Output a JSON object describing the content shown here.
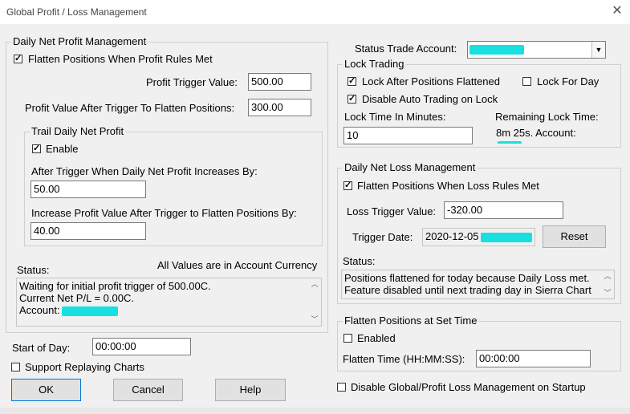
{
  "window": {
    "title": "Global Profit / Loss Management",
    "close_glyph": "✕"
  },
  "profit": {
    "legend": "Daily Net Profit Management",
    "flatten_label": "Flatten Positions When Profit Rules Met",
    "flatten_checked": true,
    "trigger_label": "Profit Trigger Value:",
    "trigger_value": "500.00",
    "after_label": "Profit Value After Trigger To Flatten Positions:",
    "after_value": "300.00",
    "trail": {
      "legend": "Trail Daily Net Profit",
      "enable_label": "Enable",
      "enable_checked": true,
      "increase_label": "After Trigger When Daily Net Profit Increases By:",
      "increase_value": "50.00",
      "increase_after_label": "Increase Profit Value After Trigger to Flatten Positions By:",
      "increase_after_value": "40.00"
    },
    "status_label": "Status:",
    "currency_note": "All Values are in Account Currency",
    "status_lines": [
      "Waiting for initial profit trigger of 500.00C.",
      "Current Net P/L = 0.00C.",
      "Account:"
    ]
  },
  "start_of_day": {
    "label": "Start of Day:",
    "value": "00:00:00"
  },
  "support_replay": {
    "label": "Support Replaying Charts",
    "checked": false
  },
  "buttons": {
    "ok": "OK",
    "cancel": "Cancel",
    "help": "Help",
    "reset": "Reset"
  },
  "status_trade_account": {
    "label": "Status Trade Account:",
    "value": ""
  },
  "lock": {
    "legend": "Lock Trading",
    "after_flatten_label": "Lock After Positions Flattened",
    "after_flatten_checked": true,
    "for_day_label": "Lock For Day",
    "for_day_checked": false,
    "disable_auto_label": "Disable Auto Trading on Lock",
    "disable_auto_checked": true,
    "time_label": "Lock Time In Minutes:",
    "time_value": "10",
    "remaining_label": "Remaining Lock Time:",
    "remaining_value": "8m 25s. Account:"
  },
  "loss": {
    "legend": "Daily Net Loss Management",
    "flatten_label": "Flatten Positions When Loss Rules Met",
    "flatten_checked": true,
    "trigger_label": "Loss Trigger Value:",
    "trigger_value": "-320.00",
    "date_label": "Trigger Date:",
    "date_value": "2020-12-05",
    "status_label": "Status:",
    "status_lines": [
      "Positions flattened for today because Daily Loss met.",
      "Feature disabled until next trading day in Sierra Chart"
    ]
  },
  "flatten_time": {
    "legend": "Flatten Positions at Set Time",
    "enabled_label": "Enabled",
    "enabled_checked": false,
    "time_label": "Flatten Time (HH:MM:SS):",
    "time_value": "00:00:00"
  },
  "disable_global": {
    "label": "Disable Global/Profit Loss Management on Startup",
    "checked": false
  },
  "colors": {
    "redaction": "#18e0e0",
    "default_button_border": "#0078d7"
  }
}
